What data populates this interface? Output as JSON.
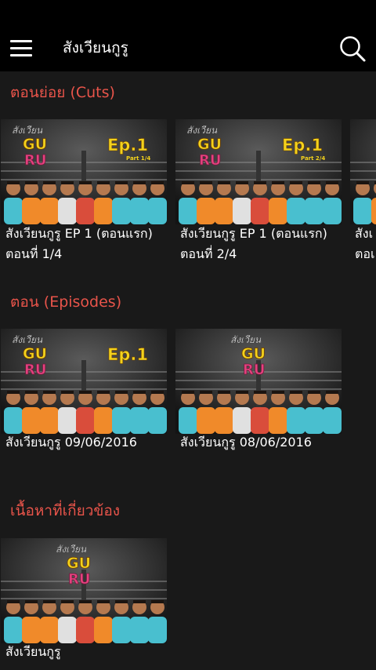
{
  "header": {
    "title": "สังเวียนกูรู",
    "menu_icon": "hamburger-menu-icon",
    "search_icon": "search-icon"
  },
  "sections": [
    {
      "title": "ตอนย่อย (Cuts)",
      "items": [
        {
          "line1": "สังเวียนกูรู EP 1 (ตอนแรก)",
          "line2": "ตอนที่ 1/4",
          "ep": "Ep.1",
          "part": "Part 1/4"
        },
        {
          "line1": "สังเวียนกูรู EP 1 (ตอนแรก)",
          "line2": "ตอนที่ 2/4",
          "ep": "Ep.1",
          "part": "Part 2/4"
        },
        {
          "line1": "สังเ",
          "line2": "ตอเ"
        }
      ]
    },
    {
      "title": "ตอน (Episodes)",
      "items": [
        {
          "line1": "สังเวียนกูรู 09/06/2016",
          "ep": "Ep.1"
        },
        {
          "line1": "สังเวียนกูรู 08/06/2016"
        }
      ]
    },
    {
      "title": "เนื้อหาที่เกี่ยวข้อง",
      "items": [
        {
          "line1": "สังเวียนกูรู"
        }
      ]
    }
  ],
  "logo": {
    "script_text": "สังเวียน",
    "gu": "GU",
    "ru": "RU"
  },
  "colors": {
    "header_bg": "#000000",
    "page_bg": "#191919",
    "section_title": "#e8544a",
    "logo_yellow": "#f3d21c",
    "logo_pink": "#e6417f"
  }
}
